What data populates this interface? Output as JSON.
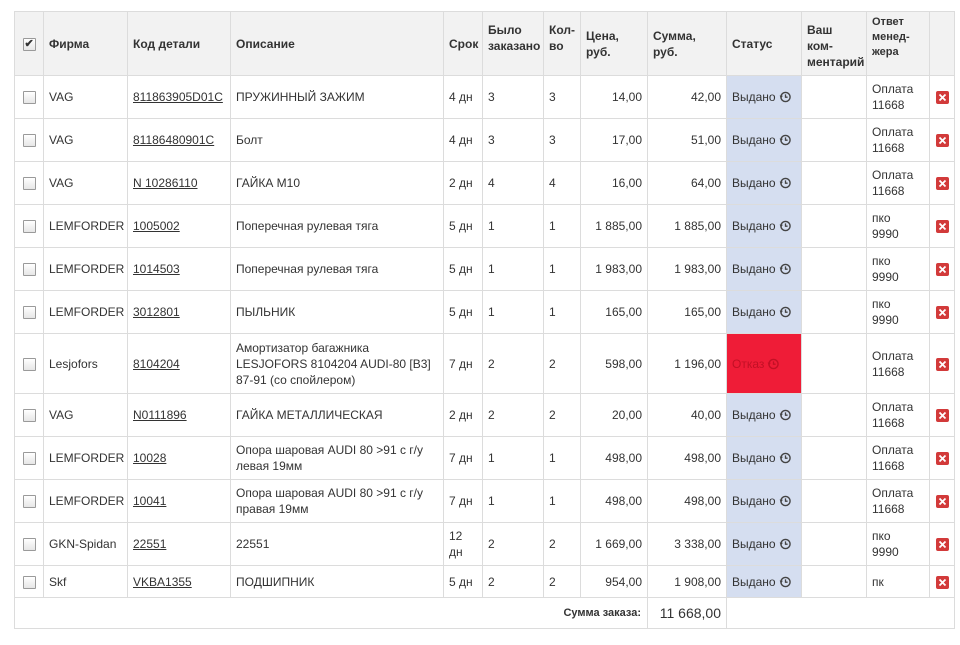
{
  "headers": {
    "firm": "Фирма",
    "part_code": "Код детали",
    "description": "Описание",
    "term": "Срок",
    "ordered_l1": "Было",
    "ordered_l2": "заказано",
    "qty_l1": "Кол-",
    "qty_l2": "во",
    "price": "Цена, руб.",
    "sum": "Сумма, руб.",
    "status": "Статус",
    "comment_l1": "Ваш ком-",
    "comment_l2": "ментарий",
    "answer_l1": "Ответ",
    "answer_l2": "менед-",
    "answer_l3": "жера"
  },
  "rows": [
    {
      "firm": "VAG",
      "code": "811863905D01C",
      "desc": [
        "ПРУЖИННЫЙ ЗАЖИМ"
      ],
      "term": [
        "4 дн"
      ],
      "ordered": "3",
      "qty": "3",
      "price": "14,00",
      "sum": "42,00",
      "status": "Выдано",
      "status_type": "issued",
      "answer": [
        "Оплата",
        "11668"
      ]
    },
    {
      "firm": "VAG",
      "code": "81186480901C",
      "desc": [
        "Болт"
      ],
      "term": [
        "4 дн"
      ],
      "ordered": "3",
      "qty": "3",
      "price": "17,00",
      "sum": "51,00",
      "status": "Выдано",
      "status_type": "issued",
      "answer": [
        "Оплата",
        "11668"
      ]
    },
    {
      "firm": "VAG",
      "code": "N 10286110",
      "desc": [
        "ГАЙКА М10"
      ],
      "term": [
        "2 дн"
      ],
      "ordered": "4",
      "qty": "4",
      "price": "16,00",
      "sum": "64,00",
      "status": "Выдано",
      "status_type": "issued",
      "answer": [
        "Оплата",
        "11668"
      ]
    },
    {
      "firm": "LEMFORDER",
      "code": "1005002",
      "desc": [
        "Поперечная рулевая тяга"
      ],
      "term": [
        "5 дн"
      ],
      "ordered": "1",
      "qty": "1",
      "price": "1 885,00",
      "sum": "1 885,00",
      "status": "Выдано",
      "status_type": "issued",
      "answer": [
        "пко",
        "9990"
      ]
    },
    {
      "firm": "LEMFORDER",
      "code": "1014503",
      "desc": [
        "Поперечная рулевая тяга"
      ],
      "term": [
        "5 дн"
      ],
      "ordered": "1",
      "qty": "1",
      "price": "1 983,00",
      "sum": "1 983,00",
      "status": "Выдано",
      "status_type": "issued",
      "answer": [
        "пко",
        "9990"
      ]
    },
    {
      "firm": "LEMFORDER",
      "code": "3012801",
      "desc": [
        "ПЫЛЬНИК"
      ],
      "term": [
        "5 дн"
      ],
      "ordered": "1",
      "qty": "1",
      "price": "165,00",
      "sum": "165,00",
      "status": "Выдано",
      "status_type": "issued",
      "answer": [
        "пко",
        "9990"
      ]
    },
    {
      "firm": "Lesjofors",
      "code": "8104204",
      "desc": [
        "Амортизатор багажника",
        "LESJOFORS 8104204 AUDI-80 [B3]",
        "87-91 (со спойлером)"
      ],
      "term": [
        "7 дн"
      ],
      "ordered": "2",
      "qty": "2",
      "price": "598,00",
      "sum": "1 196,00",
      "status": "Отказ",
      "status_type": "refused",
      "answer": [
        "Оплата",
        "11668"
      ]
    },
    {
      "firm": "VAG",
      "code": "N0111896",
      "desc": [
        "ГАЙКА МЕТАЛЛИЧЕСКАЯ"
      ],
      "term": [
        "2 дн"
      ],
      "ordered": "2",
      "qty": "2",
      "price": "20,00",
      "sum": "40,00",
      "status": "Выдано",
      "status_type": "issued",
      "answer": [
        "Оплата",
        "11668"
      ]
    },
    {
      "firm": "LEMFORDER",
      "code": "10028",
      "desc": [
        "Опора шаровая AUDI 80 >91 с г/у",
        "левая 19мм"
      ],
      "term": [
        "7 дн"
      ],
      "ordered": "1",
      "qty": "1",
      "price": "498,00",
      "sum": "498,00",
      "status": "Выдано",
      "status_type": "issued",
      "answer": [
        "Оплата",
        "11668"
      ]
    },
    {
      "firm": "LEMFORDER",
      "code": "10041",
      "desc": [
        "Опора шаровая AUDI 80 >91 с г/у",
        "правая 19мм"
      ],
      "term": [
        "7 дн"
      ],
      "ordered": "1",
      "qty": "1",
      "price": "498,00",
      "sum": "498,00",
      "status": "Выдано",
      "status_type": "issued",
      "answer": [
        "Оплата",
        "11668"
      ]
    },
    {
      "firm": "GKN-Spidan",
      "code": "22551",
      "desc": [
        "22551"
      ],
      "term": [
        "12",
        "дн"
      ],
      "ordered": "2",
      "qty": "2",
      "price": "1 669,00",
      "sum": "3 338,00",
      "status": "Выдано",
      "status_type": "issued",
      "answer": [
        "пко",
        "9990"
      ]
    },
    {
      "firm": "Skf",
      "code": "VKBA1355",
      "desc": [
        "ПОДШИПНИК"
      ],
      "term": [
        "5 дн"
      ],
      "ordered": "2",
      "qty": "2",
      "price": "954,00",
      "sum": "1 908,00",
      "status": "Выдано",
      "status_type": "issued",
      "answer": [
        "пк"
      ]
    }
  ],
  "footer": {
    "label": "Сумма заказа:",
    "total": "11 668,00"
  },
  "colors": {
    "status_issued_bg": "#d5def0",
    "status_refused_bg": "#ef1c37",
    "delete_button": "#d23a3a"
  },
  "icons": {
    "status_history": "history-icon",
    "delete": "delete-icon",
    "select_all": "checkbox-checked-icon"
  }
}
